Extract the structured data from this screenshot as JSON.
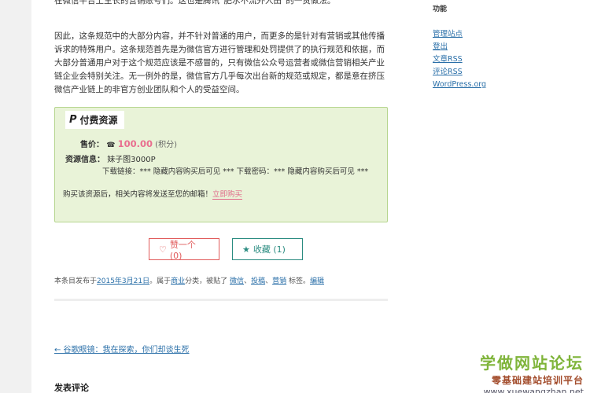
{
  "article": {
    "para1": "在微信平台上生长的营销账号们。这也是腾讯“肥水不流外人田”的一贯做法。",
    "para2": "因此，这条规范中的大部分内容，并不针对普通的用户，而更多的是针对有营销或其他传播诉求的特殊用户。这条规范首先是为微信官方进行管理和处罚提供了的执行规范和依据，而大部分普通用户对于这个规范应该是不感冒的，只有微信公众号运营者或微信营销相关产业链企业会特别关注。无一例外的是，微信官方几乎每次出台新的规范或规定，都是意在挤压微信产业链上的非官方创业团队和个人的受益空间。"
  },
  "resource_box": {
    "title": "付费资源",
    "title_icon": "paypal-icon",
    "price_label": "售价：",
    "price_value": "100.00",
    "price_unit": "(积分)",
    "info_label": "资源信息：",
    "info_value": "妹子图3000P",
    "download_text": "下载链接：*** 隐藏内容购买后可见 ***   下载密码：*** 隐藏内容购买后可见 ***",
    "notice": "购买该资源后，相关内容将发送至您的邮箱！",
    "buy_link": "立即购买"
  },
  "actions": {
    "like_label": "赞一个 (0)",
    "fav_label": "收藏 (1)"
  },
  "meta": {
    "prefix": "本条目发布于",
    "date": "2015年3月21日",
    "cat_prefix": "。属于",
    "category": "商业",
    "tag_prefix": "分类，被贴了",
    "tag1": "微信",
    "tag2": "投稿",
    "tag3": "营销",
    "tag_suffix": "标签。",
    "edit": "编辑"
  },
  "nav": {
    "prev": "← 谷歌眼镜：我在探索，你们却谈生死"
  },
  "comments": {
    "title": "发表评论"
  },
  "sidebar": {
    "title": "功能",
    "items": [
      "管理站点",
      "登出",
      "文章RSS",
      "评论RSS",
      "WordPress.org"
    ]
  },
  "watermark": {
    "line1": "学做网站论坛",
    "line2": "零基础建站培训平台",
    "line3": "www.xuewangzhan.net"
  }
}
